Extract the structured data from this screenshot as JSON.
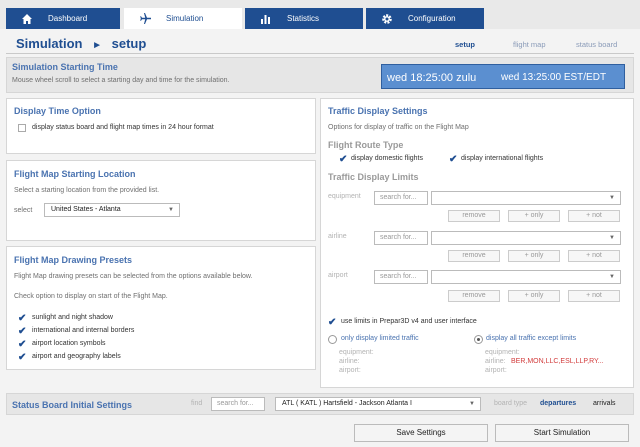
{
  "tabs": [
    {
      "label": "Dashboard",
      "icon": "home-icon"
    },
    {
      "label": "Simulation",
      "icon": "airplane-icon"
    },
    {
      "label": "Statistics",
      "icon": "bar-chart-icon"
    },
    {
      "label": "Configuration",
      "icon": "gear-icon"
    }
  ],
  "page": {
    "title_part1": "Simulation",
    "title_arrow": "►",
    "title_part2": "setup",
    "nav": [
      "setup",
      "flight map",
      "status board"
    ]
  },
  "start_time": {
    "heading": "Simulation Starting Time",
    "help": "Mouse wheel scroll to select a starting day and time for the simulation.",
    "zulu": "wed 18:25:00 zulu",
    "local": "wed 13:25:00 EST/EDT"
  },
  "display_time": {
    "heading": "Display Time Option",
    "option": "display status board and flight map times in 24 hour format"
  },
  "starting_location": {
    "heading": "Flight Map Starting Location",
    "help": "Select a starting location from the provided list.",
    "select_label": "select",
    "value": "United States - Atlanta"
  },
  "presets": {
    "heading": "Flight Map Drawing Presets",
    "help1": "Flight Map drawing presets can be selected from the options available below.",
    "help2": "Check option to display on start of the Flight Map.",
    "options": [
      "sunlight and night shadow",
      "international and internal borders",
      "airport location symbols",
      "airport and geography labels"
    ]
  },
  "traffic": {
    "heading": "Traffic Display Settings",
    "help": "Options for display of traffic on the Flight Map",
    "route_heading": "Flight Route Type",
    "domestic": "display domestic flights",
    "international": "display international flights",
    "limits_heading": "Traffic Display Limits",
    "rows": [
      {
        "label": "equipment",
        "placeholder": "search for..."
      },
      {
        "label": "airline",
        "placeholder": "search for..."
      },
      {
        "label": "airport",
        "placeholder": "search for..."
      }
    ],
    "remove": "remove",
    "only": "+ only",
    "not": "+ not",
    "use_limits": "use limits in Prepar3D v4 and user interface",
    "only_limited": "only display limited traffic",
    "all_except": "display all traffic except limits",
    "left_list": [
      "equipment:",
      "airline:",
      "airport:"
    ],
    "right_list": [
      "equipment:",
      "airline:",
      "airport:"
    ],
    "airline_values": "BER,MON,LLC,ESL,LLP,RY..."
  },
  "status_board": {
    "heading": "Status Board Initial Settings",
    "find_label": "find",
    "find_placeholder": "search for...",
    "airport": "ATL ( KATL ) Hartsfield - Jackson Atlanta I",
    "board_type_label": "board type",
    "departures": "departures",
    "arrivals": "arrivals"
  },
  "buttons": {
    "save": "Save Settings",
    "start": "Start Simulation"
  },
  "colors": {
    "brand": "#1f4e91",
    "time_box": "#5b8fd0",
    "accent_text": "#4a73b0"
  }
}
